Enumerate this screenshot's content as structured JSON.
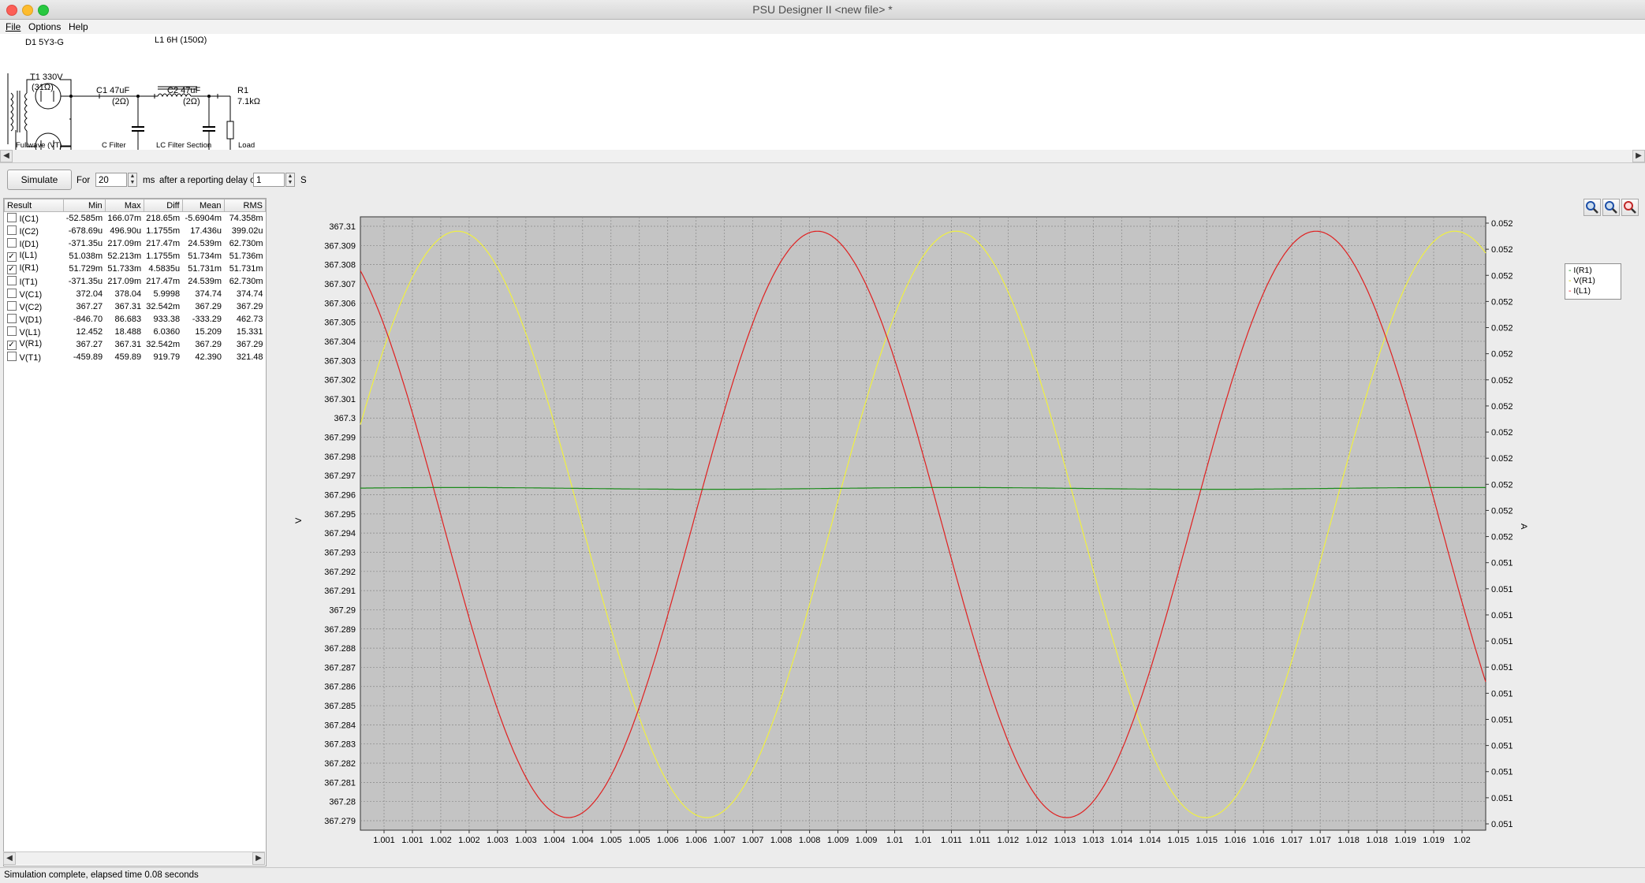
{
  "window": {
    "title": "PSU Designer II  <new file> *"
  },
  "menu": {
    "file": "File",
    "options": "Options",
    "help": "Help"
  },
  "schematic": {
    "d1": "D1 5Y3-G",
    "l1": "L1 6H (150Ω)",
    "t1_a": "T1 330V",
    "t1_b": "(31Ω)",
    "c1_a": "C1 47uF",
    "c1_b": "(2Ω)",
    "c2_a": "C2 47uF",
    "c2_b": "(2Ω)",
    "r1_a": "R1",
    "r1_b": "7.1kΩ",
    "sec_fullwave": "Fullwave (VT)",
    "sec_cfilter": "C Filter",
    "sec_lc": "LC Filter Section",
    "sec_load": "Load"
  },
  "controls": {
    "simulate": "Simulate",
    "for": "For",
    "duration": "20",
    "ms": "ms",
    "after": "after a reporting delay of",
    "delay": "1",
    "s": "S"
  },
  "results": {
    "headers": [
      "Result",
      "Min",
      "Max",
      "Diff",
      "Mean",
      "RMS"
    ],
    "rows": [
      {
        "name": "I(C1)",
        "checked": false,
        "min": "-52.585m",
        "max": "166.07m",
        "diff": "218.65m",
        "mean": "-5.6904m",
        "rms": "74.358m"
      },
      {
        "name": "I(C2)",
        "checked": false,
        "min": "-678.69u",
        "max": "496.90u",
        "diff": "1.1755m",
        "mean": "17.436u",
        "rms": "399.02u"
      },
      {
        "name": "I(D1)",
        "checked": false,
        "min": "-371.35u",
        "max": "217.09m",
        "diff": "217.47m",
        "mean": "24.539m",
        "rms": "62.730m"
      },
      {
        "name": "I(L1)",
        "checked": true,
        "min": "51.038m",
        "max": "52.213m",
        "diff": "1.1755m",
        "mean": "51.734m",
        "rms": "51.736m"
      },
      {
        "name": "I(R1)",
        "checked": true,
        "min": "51.729m",
        "max": "51.733m",
        "diff": "4.5835u",
        "mean": "51.731m",
        "rms": "51.731m"
      },
      {
        "name": "I(T1)",
        "checked": false,
        "min": "-371.35u",
        "max": "217.09m",
        "diff": "217.47m",
        "mean": "24.539m",
        "rms": "62.730m"
      },
      {
        "name": "V(C1)",
        "checked": false,
        "min": "372.04",
        "max": "378.04",
        "diff": "5.9998",
        "mean": "374.74",
        "rms": "374.74"
      },
      {
        "name": "V(C2)",
        "checked": false,
        "min": "367.27",
        "max": "367.31",
        "diff": "32.542m",
        "mean": "367.29",
        "rms": "367.29"
      },
      {
        "name": "V(D1)",
        "checked": false,
        "min": "-846.70",
        "max": "86.683",
        "diff": "933.38",
        "mean": "-333.29",
        "rms": "462.73"
      },
      {
        "name": "V(L1)",
        "checked": false,
        "min": "12.452",
        "max": "18.488",
        "diff": "6.0360",
        "mean": "15.209",
        "rms": "15.331"
      },
      {
        "name": "V(R1)",
        "checked": true,
        "min": "367.27",
        "max": "367.31",
        "diff": "32.542m",
        "mean": "367.29",
        "rms": "367.29"
      },
      {
        "name": "V(T1)",
        "checked": false,
        "min": "-459.89",
        "max": "459.89",
        "diff": "919.79",
        "mean": "42.390",
        "rms": "321.48"
      }
    ]
  },
  "status": {
    "text": "Simulation complete, elapsed time 0.08 seconds"
  },
  "legend": {
    "items": [
      "I(R1)",
      "V(R1)",
      "I(L1)"
    ]
  },
  "chart_data": {
    "type": "line",
    "ylabel_left": "V",
    "ylabel_right": "A",
    "left_ticks": [
      "367.31",
      "367.309",
      "367.308",
      "367.307",
      "367.306",
      "367.305",
      "367.304",
      "367.303",
      "367.302",
      "367.301",
      "367.3",
      "367.299",
      "367.298",
      "367.297",
      "367.296",
      "367.295",
      "367.294",
      "367.293",
      "367.292",
      "367.291",
      "367.29",
      "367.289",
      "367.288",
      "367.287",
      "367.286",
      "367.285",
      "367.284",
      "367.283",
      "367.282",
      "367.281",
      "367.28",
      "367.279"
    ],
    "right_ticks": [
      "0.052",
      "0.052",
      "0.052",
      "0.052",
      "0.052",
      "0.052",
      "0.052",
      "0.052",
      "0.052",
      "0.052",
      "0.052",
      "0.052",
      "0.052",
      "0.051",
      "0.051",
      "0.051",
      "0.051",
      "0.051",
      "0.051",
      "0.051",
      "0.051",
      "0.051",
      "0.051",
      "0.051"
    ],
    "x_ticks": [
      "1.001",
      "1.001",
      "1.002",
      "1.002",
      "1.003",
      "1.003",
      "1.004",
      "1.004",
      "1.005",
      "1.005",
      "1.006",
      "1.006",
      "1.007",
      "1.007",
      "1.008",
      "1.008",
      "1.009",
      "1.009",
      "1.01",
      "1.01",
      "1.011",
      "1.011",
      "1.012",
      "1.012",
      "1.013",
      "1.013",
      "1.014",
      "1.014",
      "1.015",
      "1.015",
      "1.016",
      "1.016",
      "1.017",
      "1.017",
      "1.018",
      "1.018",
      "1.019",
      "1.019",
      "1.02"
    ],
    "xlim": [
      1.0005,
      1.0202
    ],
    "ylim_left": [
      367.2783,
      367.3124
    ],
    "series": [
      {
        "name": "V(R1)",
        "axis": "left",
        "color": "#f0f040",
        "period": 0.00873,
        "amplitude": 0.0163,
        "offset": 367.2953,
        "phase_peak_x": 1.0022
      },
      {
        "name": "I(L1)",
        "axis": "left",
        "color": "#e02020",
        "period": 0.00873,
        "amplitude": 0.0163,
        "offset": 367.2953,
        "phase_peak_x": 1.0085
      },
      {
        "name": "I(R1)",
        "axis": "left",
        "color": "#1a8a1a",
        "period": 0.00873,
        "amplitude": 5e-05,
        "offset": 367.2973,
        "phase_peak_x": 1.0022
      }
    ],
    "grid": true,
    "legend_position": "top-right"
  }
}
